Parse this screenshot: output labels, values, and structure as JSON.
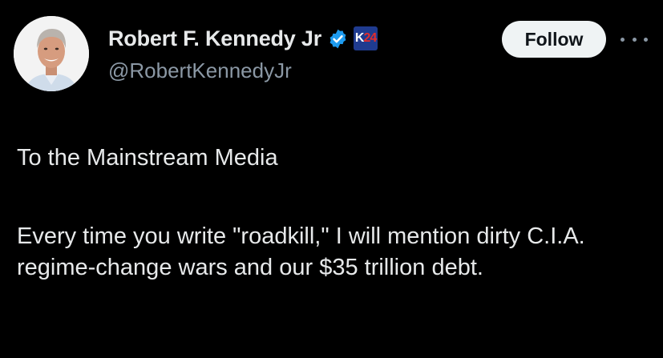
{
  "author": {
    "display_name": "Robert F. Kennedy Jr",
    "handle": "@RobertKennedyJr",
    "verified": true,
    "affiliation_badge": {
      "letter": "K",
      "number": "24"
    },
    "avatar_icon": "profile-photo"
  },
  "actions": {
    "follow_label": "Follow",
    "more_icon": "more-horizontal-icon"
  },
  "tweet": {
    "line1": "To the Mainstream Media",
    "line2": "Every time you write \"roadkill,\" I will mention dirty C.I.A. regime-change wars and our $35 trillion debt."
  },
  "colors": {
    "background": "#000000",
    "text_primary": "#e7e9ea",
    "text_secondary": "#8b98a5",
    "verified_blue": "#1d9bf0",
    "follow_bg": "#eff3f4",
    "follow_text": "#0f1419",
    "badge_bg": "#1f3b8f",
    "badge_number": "#e32c2c"
  }
}
